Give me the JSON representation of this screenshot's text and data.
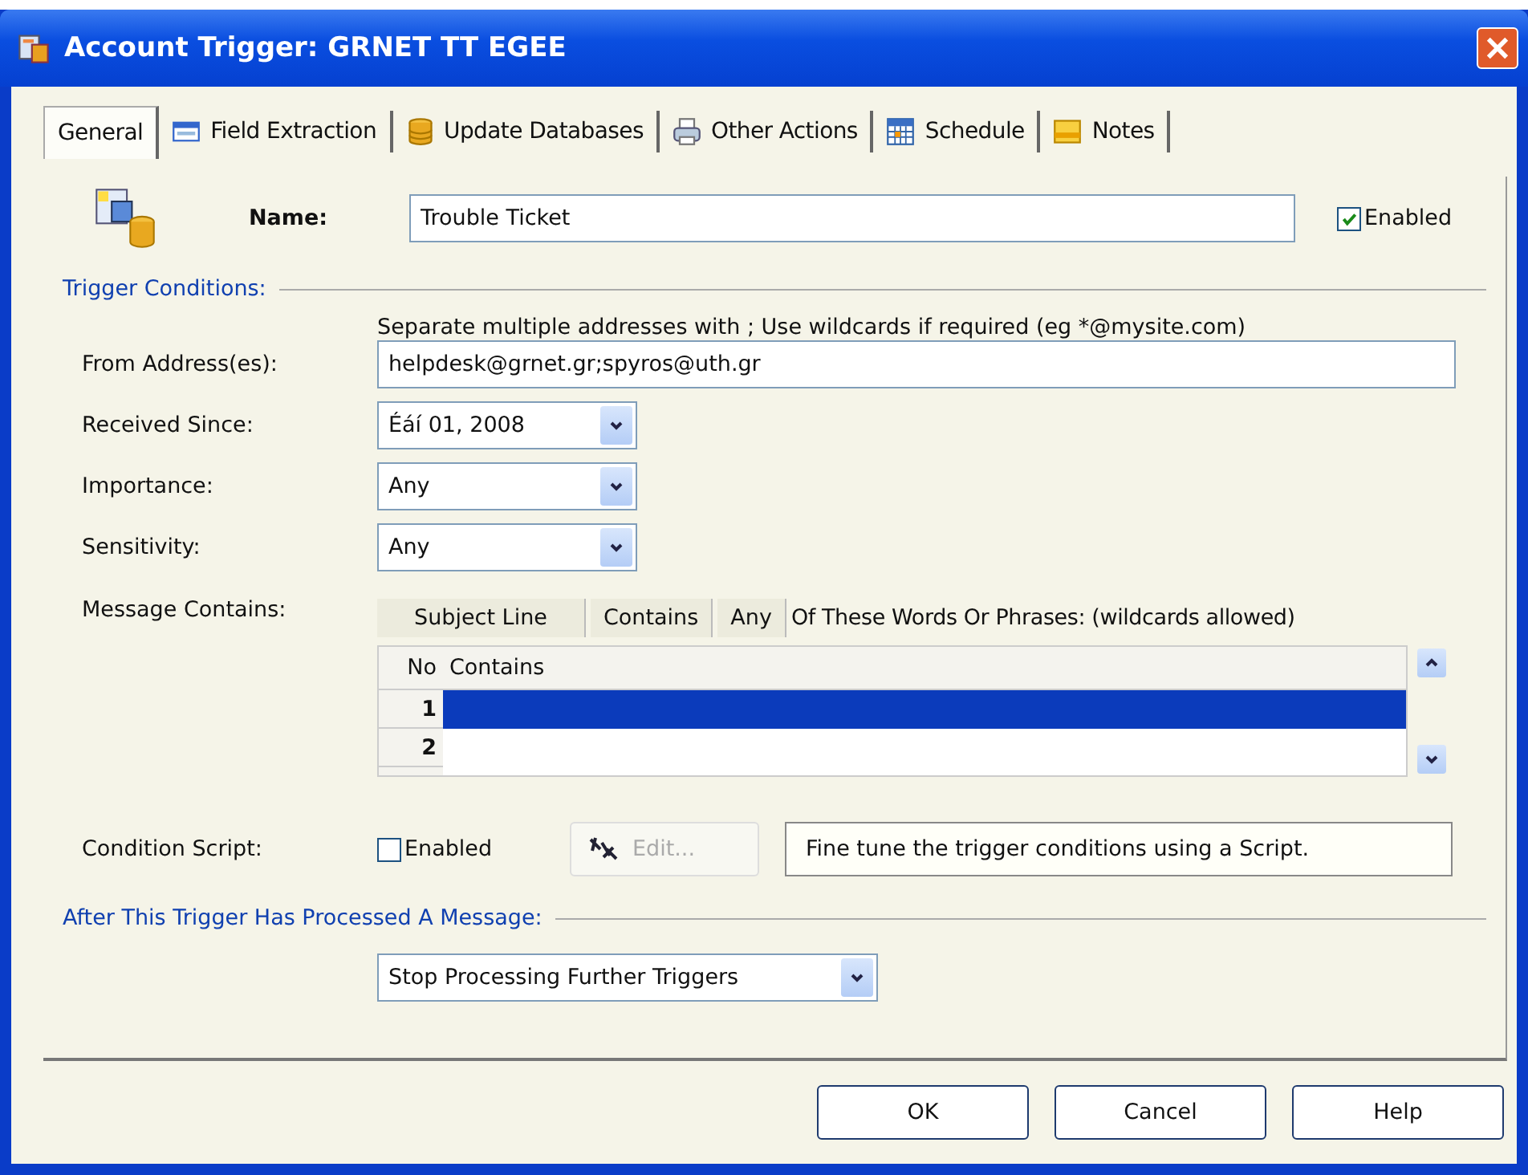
{
  "window": {
    "title": "Account Trigger: GRNET TT EGEE"
  },
  "tabs": [
    {
      "label": "General",
      "selected": true
    },
    {
      "label": "Field Extraction",
      "selected": false
    },
    {
      "label": "Update Databases",
      "selected": false
    },
    {
      "label": "Other Actions",
      "selected": false
    },
    {
      "label": "Schedule",
      "selected": false
    },
    {
      "label": "Notes",
      "selected": false
    }
  ],
  "name": {
    "label": "Name:",
    "value": "Trouble Ticket",
    "enabled_label": "Enabled",
    "enabled": true
  },
  "trigger_conditions": {
    "heading": "Trigger Conditions:",
    "hint": "Separate multiple addresses with ; Use wildcards if required (eg *@mysite.com)",
    "from_label": "From Address(es):",
    "from_value": "helpdesk@grnet.gr;spyros@uth.gr",
    "combos": [
      {
        "label": "Received Since:",
        "value": "Éáí 01, 2008"
      },
      {
        "label": "Importance:",
        "value": "Any"
      },
      {
        "label": "Sensitivity:",
        "value": "Any"
      }
    ],
    "message_label": "Message Contains:",
    "message_parts": [
      {
        "kind": "button",
        "text": "Subject Line"
      },
      {
        "kind": "button",
        "text": "Contains"
      },
      {
        "kind": "button",
        "text": "Any"
      },
      {
        "kind": "text",
        "text": "Of These Words Or Phrases: (wildcards allowed)"
      }
    ],
    "grid": {
      "columns": [
        "No",
        "Contains"
      ],
      "rows": [
        {
          "no": "1",
          "selected": true
        },
        {
          "no": "2",
          "selected": false
        }
      ]
    },
    "script_label": "Condition Script:",
    "script_enabled_label": "Enabled",
    "script_enabled": false,
    "edit_button": {
      "label": "Edit...",
      "disabled": true
    },
    "script_note": "Fine tune the trigger conditions using a Script."
  },
  "after": {
    "heading": "After This Trigger Has Processed A Message:",
    "value": "Stop Processing Further Triggers"
  },
  "buttons": [
    "OK",
    "Cancel",
    "Help"
  ]
}
